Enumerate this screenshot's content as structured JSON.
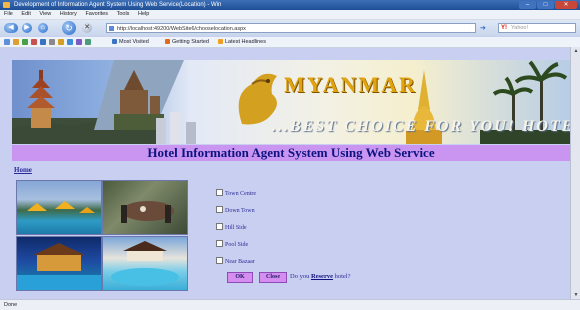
{
  "window": {
    "title": "Development of Information Agent System Using Web Service(Location) - Win",
    "controls": [
      "–",
      "□",
      "✕"
    ]
  },
  "menu": [
    "File",
    "Edit",
    "View",
    "History",
    "Favorites",
    "Tools",
    "Help"
  ],
  "address_bar": {
    "url": "http://localhost:49200/WebSite6/chooselocation.aspx",
    "search_placeholder": "Yahoo!"
  },
  "favorites": [
    "Most Visited",
    "Getting Started",
    "Latest Headlines"
  ],
  "banner": {
    "title": "MYANMAR",
    "tagline": "...BEST CHOICE FOR YOU! HOTEL"
  },
  "page": {
    "heading": "Hotel Information Agent System Using Web Service",
    "home_link": "Home"
  },
  "locations": [
    "Town Centre",
    "Down Town",
    "Hill Side",
    "Pool Side",
    "Near Bazaar"
  ],
  "buttons": {
    "ok": "OK",
    "close": "Close"
  },
  "reserve_prompt": {
    "prefix": "Do you",
    "link": "Reserve",
    "suffix": "hotel?"
  },
  "status": "Done",
  "colors": {
    "page_background": "#c9cff0",
    "heading_bar": "#c995f0",
    "heading_text": "#0d1480",
    "button": "#d58ef0"
  }
}
